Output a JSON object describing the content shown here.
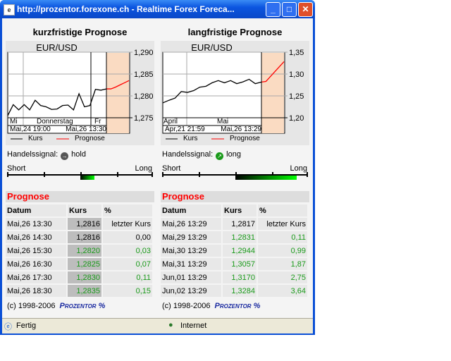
{
  "window": {
    "title": "http://prozentor.forexone.ch - Realtime Forex Foreca...",
    "min": "_",
    "max": "□",
    "close": "✕"
  },
  "panels": [
    {
      "heading": "kurzfristige Prognose",
      "pair": "EUR/USD",
      "yticks": [
        "1,290",
        "1,285",
        "1,280",
        "1,275"
      ],
      "xlabels": [
        "Mi",
        "Donnerstag",
        "Fr"
      ],
      "start": "Mai,24 19:00",
      "end": "Mai,26 13:30",
      "legend_kurs": "Kurs",
      "legend_prognose": "Prognose",
      "signal_label": "Handelssignal:",
      "signal": "hold",
      "short": "Short",
      "long": "Long",
      "signal_strength": 0.2,
      "prognose_title": "Prognose",
      "headers": [
        "Datum",
        "Kurs",
        "%"
      ],
      "rows": [
        [
          "Mai,26 13:30",
          "1,2816",
          "letzter Kurs"
        ],
        [
          "Mai,26 14:30",
          "1,2816",
          "0,00"
        ],
        [
          "Mai,26 15:30",
          "1,2820",
          "0,03"
        ],
        [
          "Mai,26 16:30",
          "1,2825",
          "0,07"
        ],
        [
          "Mai,26 17:30",
          "1,2830",
          "0,11"
        ],
        [
          "Mai,26 18:30",
          "1,2835",
          "0,15"
        ]
      ],
      "copyright": "(c) 1998-2006",
      "brand": "Prozentor %"
    },
    {
      "heading": "langfristige Prognose",
      "pair": "EUR/USD",
      "yticks": [
        "1,35",
        "1,30",
        "1,25",
        "1,20"
      ],
      "xlabels": [
        "April",
        "Mai"
      ],
      "start": "Apr,21 21:59",
      "end": "Mai,26 13:29",
      "legend_kurs": "Kurs",
      "legend_prognose": "Prognose",
      "signal_label": "Handelssignal:",
      "signal": "long",
      "short": "Short",
      "long": "Long",
      "signal_strength": 0.85,
      "prognose_title": "Prognose",
      "headers": [
        "Datum",
        "Kurs",
        "%"
      ],
      "rows": [
        [
          "Mai,26 13:29",
          "1,2817",
          "letzter Kurs"
        ],
        [
          "Mai,29 13:29",
          "1,2831",
          "0,11"
        ],
        [
          "Mai,30 13:29",
          "1,2944",
          "0,99"
        ],
        [
          "Mai,31 13:29",
          "1,3057",
          "1,87"
        ],
        [
          "Jun,01 13:29",
          "1,3170",
          "2,75"
        ],
        [
          "Jun,02 13:29",
          "1,3284",
          "3,64"
        ]
      ],
      "copyright": "(c) 1998-2006",
      "brand": "Prozentor %"
    }
  ],
  "chart_data": [
    {
      "type": "line",
      "title": "EUR/USD",
      "ylim": [
        1.275,
        1.29
      ],
      "series": [
        {
          "name": "Kurs",
          "values": [
            1.2755,
            1.278,
            1.2768,
            1.278,
            1.2768,
            1.279,
            1.2778,
            1.2775,
            1.2769,
            1.277,
            1.2778,
            1.2779,
            1.2768,
            1.2805,
            1.2775,
            1.2778,
            1.2815,
            1.2813,
            1.2816
          ]
        },
        {
          "name": "Prognose",
          "values": [
            1.2816,
            1.2816,
            1.282,
            1.2825,
            1.283,
            1.2835
          ]
        }
      ]
    },
    {
      "type": "line",
      "title": "EUR/USD",
      "ylim": [
        1.2,
        1.35
      ],
      "series": [
        {
          "name": "Kurs",
          "values": [
            1.234,
            1.24,
            1.245,
            1.26,
            1.258,
            1.262,
            1.27,
            1.272,
            1.28,
            1.285,
            1.28,
            1.285,
            1.278,
            1.282,
            1.288,
            1.278,
            1.2817
          ]
        },
        {
          "name": "Prognose",
          "values": [
            1.2817,
            1.2831,
            1.2944,
            1.3057,
            1.317,
            1.3284
          ]
        }
      ]
    }
  ],
  "status": {
    "text": "Fertig",
    "zone": "Internet"
  }
}
